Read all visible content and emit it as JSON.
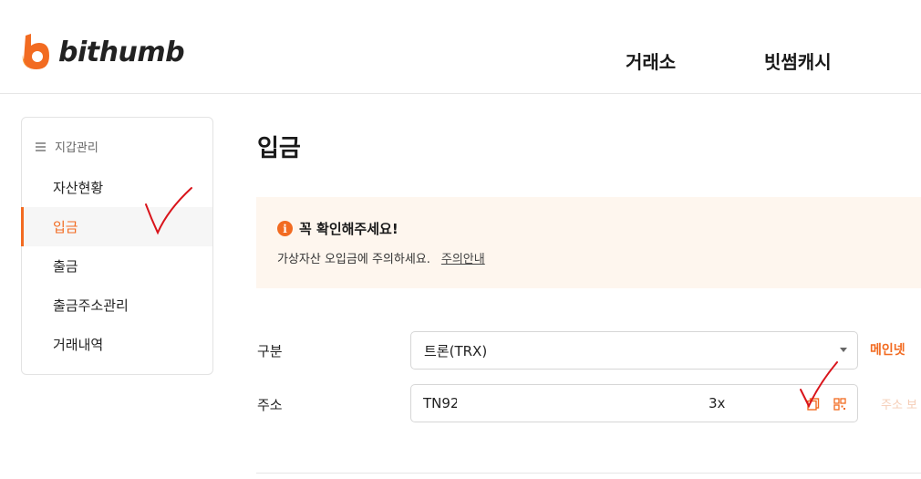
{
  "header": {
    "brand": "bithumb",
    "nav": [
      "거래소",
      "빗썸캐시"
    ]
  },
  "sidebar": {
    "heading": "지갑관리",
    "items": [
      {
        "label": "자산현황",
        "active": false
      },
      {
        "label": "입금",
        "active": true
      },
      {
        "label": "출금",
        "active": false
      },
      {
        "label": "출금주소관리",
        "active": false
      },
      {
        "label": "거래내역",
        "active": false
      }
    ]
  },
  "main": {
    "title": "입금",
    "notice": {
      "title": "꼭 확인해주세요!",
      "body": "가상자산 오입금에 주의하세요.",
      "link": "주의안내"
    },
    "form": {
      "category_label": "구분",
      "category_value": "트론(TRX)",
      "network": "메인넷",
      "address_label": "주소",
      "address_start": "TN92",
      "address_end": "3x",
      "address_link": "주소 보"
    }
  },
  "colors": {
    "accent": "#f26b21",
    "notice_bg": "#fef6ee",
    "annotation": "#d9141b"
  },
  "icons": [
    "menu-icon",
    "info-icon",
    "copy-icon",
    "qr-code-icon",
    "dropdown-caret-icon"
  ]
}
